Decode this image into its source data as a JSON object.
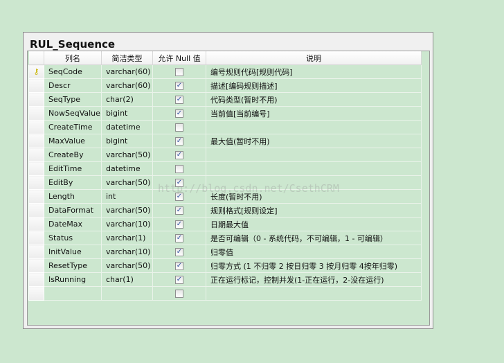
{
  "title": "RUL_Sequence",
  "headers": {
    "name": "列名",
    "type": "简洁类型",
    "null": "允许 Null 值",
    "desc": "说明"
  },
  "watermark": "http://blog.csdn.net/CsethCRM",
  "rows": [
    {
      "key": true,
      "name": "SeqCode",
      "type": "varchar(60)",
      "nullable": false,
      "desc": "编号规则代码[规则代码]"
    },
    {
      "name": "Descr",
      "type": "varchar(60)",
      "nullable": true,
      "desc": "描述[编码规则描述]"
    },
    {
      "name": "SeqType",
      "type": "char(2)",
      "nullable": true,
      "desc": "代码类型(暂时不用)"
    },
    {
      "name": "NowSeqValue",
      "type": "bigint",
      "nullable": true,
      "desc": "当前值[当前编号]"
    },
    {
      "name": "CreateTime",
      "type": "datetime",
      "nullable": false,
      "desc": ""
    },
    {
      "name": "MaxValue",
      "type": "bigint",
      "nullable": true,
      "desc": "最大值(暂时不用)"
    },
    {
      "name": "CreateBy",
      "type": "varchar(50)",
      "nullable": true,
      "desc": ""
    },
    {
      "name": "EditTime",
      "type": "datetime",
      "nullable": false,
      "desc": ""
    },
    {
      "name": "EditBy",
      "type": "varchar(50)",
      "nullable": true,
      "desc": ""
    },
    {
      "name": "Length",
      "type": "int",
      "nullable": true,
      "desc": "长度(暂时不用)"
    },
    {
      "name": "DataFormat",
      "type": "varchar(50)",
      "nullable": true,
      "desc": "规则格式[规则设定]"
    },
    {
      "name": "DateMax",
      "type": "varchar(10)",
      "nullable": true,
      "desc": "日期最大值"
    },
    {
      "name": "Status",
      "type": "varchar(1)",
      "nullable": true,
      "desc": "是否可编辑（0 - 系统代码，不可编辑，1 - 可编辑）"
    },
    {
      "name": "InitValue",
      "type": "varchar(10)",
      "nullable": true,
      "desc": "归零值"
    },
    {
      "name": "ResetType",
      "type": "varchar(50)",
      "nullable": true,
      "desc": "归零方式 (1 不归零 2 按日归零   3 按月归零   4按年归零)"
    },
    {
      "name": "IsRunning",
      "type": "char(1)",
      "nullable": true,
      "desc": "正在运行标记，控制并发(1-正在运行，2-没在运行)"
    },
    {
      "name": "",
      "type": "",
      "nullable": false,
      "desc": ""
    }
  ]
}
